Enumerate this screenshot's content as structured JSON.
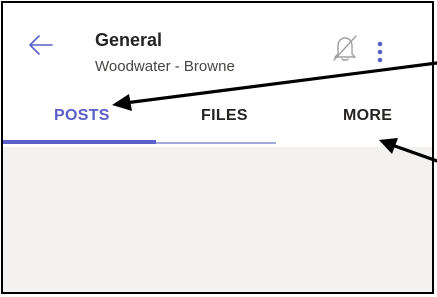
{
  "header": {
    "title": "General",
    "subtitle": "Woodwater - Browne",
    "back_icon": "back-arrow-icon",
    "bell_icon": "bell-muted-icon",
    "more_icon": "more-vertical-icon"
  },
  "tabs": [
    {
      "label": "POSTS",
      "active": true
    },
    {
      "label": "FILES",
      "active": false
    },
    {
      "label": "MORE",
      "active": false
    }
  ],
  "colors": {
    "accent": "#5b5fc7",
    "content_bg": "#f3f2f1",
    "text": "#252423"
  }
}
